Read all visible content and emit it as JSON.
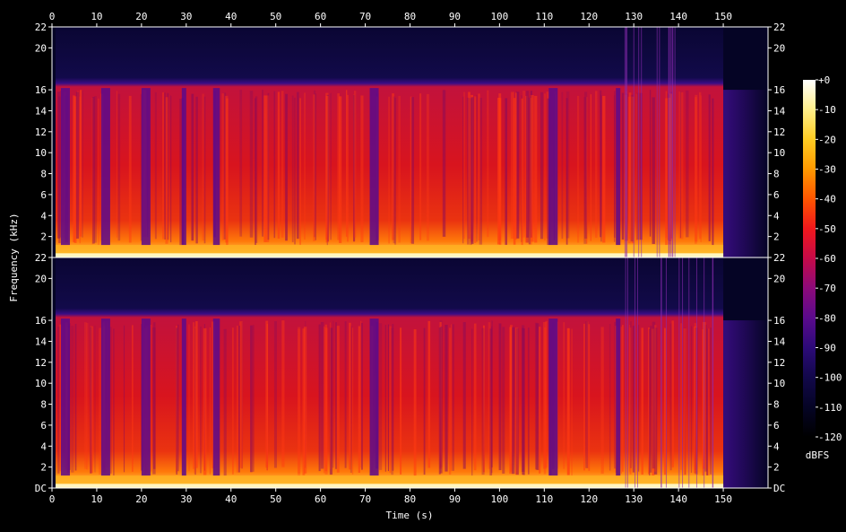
{
  "chart_data": {
    "type": "heatmap",
    "subtype": "spectrogram",
    "channels": 2,
    "xlabel": "Time (s)",
    "ylabel": "Frequency (kHz)",
    "xlim": [
      0,
      160
    ],
    "ylim_khz": [
      0,
      22
    ],
    "x_ticks": [
      "0",
      "10",
      "20",
      "30",
      "40",
      "50",
      "60",
      "70",
      "80",
      "90",
      "100",
      "110",
      "120",
      "130",
      "140",
      "150"
    ],
    "y_ticks_upper": [
      "22",
      "20",
      "16",
      "14",
      "12",
      "10",
      "8",
      "6",
      "4",
      "2"
    ],
    "y_ticks_lower": [
      "22",
      "20",
      "16",
      "14",
      "12",
      "10",
      "8",
      "6",
      "4",
      "2",
      "DC"
    ],
    "y_tick_values_upper": [
      22,
      20,
      16,
      14,
      12,
      10,
      8,
      6,
      4,
      2
    ],
    "y_tick_values_lower": [
      22,
      20,
      16,
      14,
      12,
      10,
      8,
      6,
      4,
      2,
      0
    ],
    "colorbar": {
      "label": "dBFS",
      "ticks": [
        "+0",
        "-10",
        "-20",
        "-30",
        "-40",
        "-50",
        "-60",
        "-70",
        "-80",
        "-90",
        "-100",
        "-110",
        "-120"
      ],
      "range_db": [
        -120,
        0
      ],
      "colors": [
        "#ffffff",
        "#ffef8a",
        "#ffcc22",
        "#ff9900",
        "#ff5500",
        "#f0181c",
        "#c50a48",
        "#8c0a7a",
        "#5a0a8c",
        "#2c0a78",
        "#12084a",
        "#050425",
        "#000000"
      ]
    },
    "content_cutoff_khz": 16,
    "signal_end_s": 150,
    "quiet_gaps_s": [
      [
        2,
        4
      ],
      [
        11,
        13
      ],
      [
        20,
        22
      ],
      [
        29,
        30
      ],
      [
        36,
        37.5
      ],
      [
        71,
        73
      ],
      [
        111,
        113
      ],
      [
        126,
        127
      ]
    ],
    "high_energy_band_khz": [
      0,
      4
    ]
  }
}
